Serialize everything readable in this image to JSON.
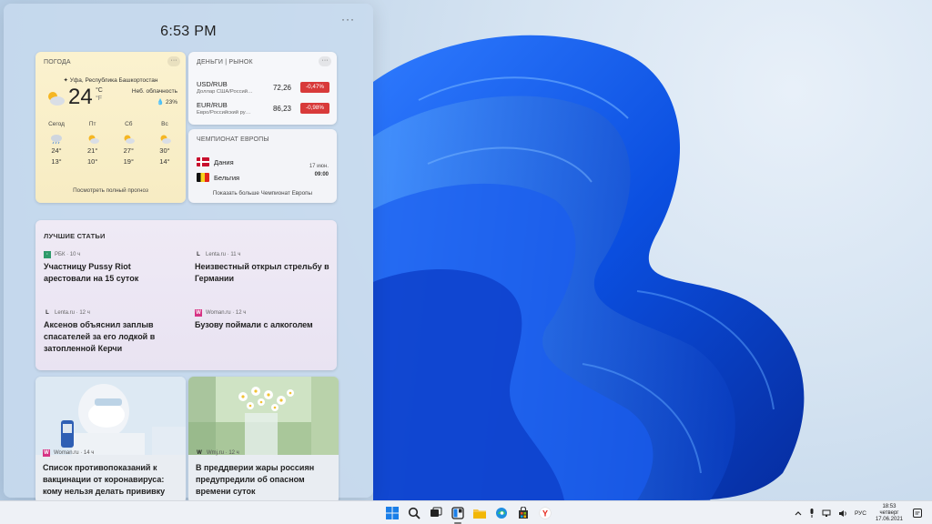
{
  "widgets_panel": {
    "time": "6:53 PM",
    "more": "···"
  },
  "weather": {
    "title": "ПОГОДА",
    "location": "✦ Уфа, Республика Башкортостан",
    "temp": "24",
    "unit_c": "°C",
    "unit_f": "°F",
    "condition": "Неб. облачность",
    "humidity": "💧 23%",
    "days": [
      {
        "name": "Сегод",
        "icon": "rain-cloud-icon",
        "hi": "24°",
        "lo": "13°"
      },
      {
        "name": "Пт",
        "icon": "partly-sunny-icon",
        "hi": "21°",
        "lo": "10°"
      },
      {
        "name": "Сб",
        "icon": "partly-sunny-icon",
        "hi": "27°",
        "lo": "19°"
      },
      {
        "name": "Вс",
        "icon": "partly-sunny-icon",
        "hi": "30°",
        "lo": "14°"
      }
    ],
    "full_forecast": "Посмотреть полный прогноз"
  },
  "market": {
    "title": "ДЕНЬГИ | РЫНОК",
    "rows": [
      {
        "pair": "USD/RUB",
        "desc": "Доллар США/Россий…",
        "value": "72,26",
        "change": "-0,47%"
      },
      {
        "pair": "EUR/RUB",
        "desc": "Евро/Российский ру…",
        "value": "86,23",
        "change": "-0,98%"
      }
    ],
    "change_color": "#d83a3a"
  },
  "euro": {
    "title": "ЧЕМПИОНАТ ЕВРОПЫ",
    "team1": "Дания",
    "team2": "Бельгия",
    "date": "17 июн.",
    "time": "09:00",
    "more": "Показать больше Чемпионат Европы"
  },
  "articles": {
    "title": "ЛУЧШИЕ СТАТЬИ",
    "items": [
      {
        "source": "РБК · 10 ч",
        "logo": "rbc-logo",
        "headline": "Участницу Pussy Riot арестовали на 15 суток"
      },
      {
        "source": "Lenta.ru · 11 ч",
        "logo": "lenta-logo",
        "headline": "Неизвестный открыл стрельбу в Германии"
      },
      {
        "source": "Lenta.ru · 12 ч",
        "logo": "lenta-logo",
        "headline": "Аксенов объяснил заплыв спасателей за его лодкой в затопленной Керчи"
      },
      {
        "source": "Woman.ru · 12 ч",
        "logo": "womanru-logo",
        "headline": "Бузову поймали с алкоголем"
      }
    ]
  },
  "photo_cards": [
    {
      "source": "Woman.ru · 14 ч",
      "headline": "Список противопоказаний к вакцинации от коронавируса: кому нельзя делать прививку"
    },
    {
      "source": "Wmj.ru · 12 ч",
      "headline": "В преддверии жары россиян предупредили об опасном времени суток"
    }
  ],
  "taskbar": {
    "icons": [
      "windows-start-icon",
      "search-icon",
      "task-view-icon",
      "widgets-icon",
      "file-explorer-icon",
      "edge-icon",
      "store-icon",
      "yandex-browser-icon"
    ],
    "tray_lang": "РУС",
    "clock_time": "18:53",
    "clock_day": "четверг",
    "clock_date": "17.06.2021"
  }
}
